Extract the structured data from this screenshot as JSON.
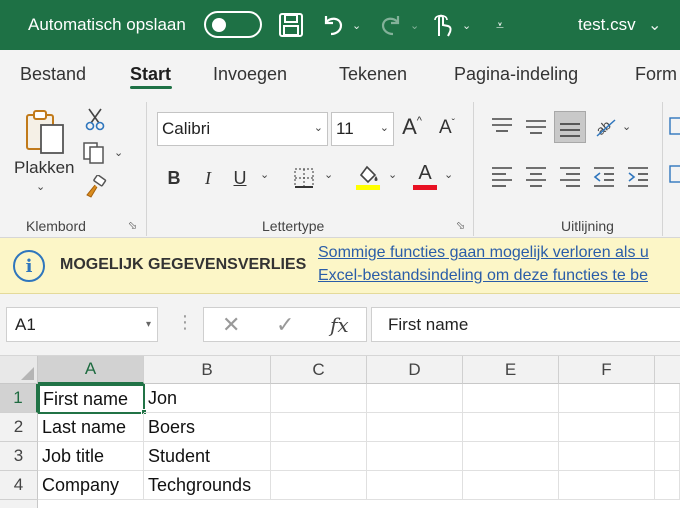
{
  "titlebar": {
    "autosave_label": "Automatisch opslaan",
    "autosave_state": "off",
    "filename": "test.csv",
    "icons": [
      "save-icon",
      "undo-icon",
      "redo-icon",
      "touch-mode-icon",
      "customize-qat-icon"
    ]
  },
  "tabs": [
    "Bestand",
    "Start",
    "Invoegen",
    "Tekenen",
    "Pagina-indeling",
    "Form"
  ],
  "active_tab": "Start",
  "ribbon": {
    "clipboard": {
      "paste_label": "Plakken",
      "group_label": "Klembord"
    },
    "font": {
      "font_name": "Calibri",
      "font_size": "11",
      "bold": "B",
      "italic": "I",
      "underline": "U",
      "font_color_letter": "A",
      "grow_letter": "A",
      "shrink_letter": "A",
      "group_label": "Lettertype",
      "highlight_color": "#ffff00",
      "font_color": "#e81123"
    },
    "alignment": {
      "group_label": "Uitlijning"
    }
  },
  "warning": {
    "title": "MOGELIJK GEGEVENSVERLIES",
    "line1": "Sommige functies gaan mogelijk verloren als u",
    "line2": "Excel-bestandsindeling om deze functies te be"
  },
  "formula_bar": {
    "name_box": "A1",
    "fx_label": "fx",
    "formula": "First name"
  },
  "grid": {
    "columns": [
      "A",
      "B",
      "C",
      "D",
      "E",
      "F"
    ],
    "rows": [
      {
        "num": "1",
        "a": "First name",
        "b": "Jon"
      },
      {
        "num": "2",
        "a": "Last name",
        "b": "Boers"
      },
      {
        "num": "3",
        "a": "Job title",
        "b": "Student"
      },
      {
        "num": "4",
        "a": "Company",
        "b": "Techgrounds"
      }
    ],
    "active_cell": "A1"
  },
  "colors": {
    "brand": "#1e7145",
    "warning_bg": "#fcf6c7",
    "link": "#2a5da8"
  }
}
